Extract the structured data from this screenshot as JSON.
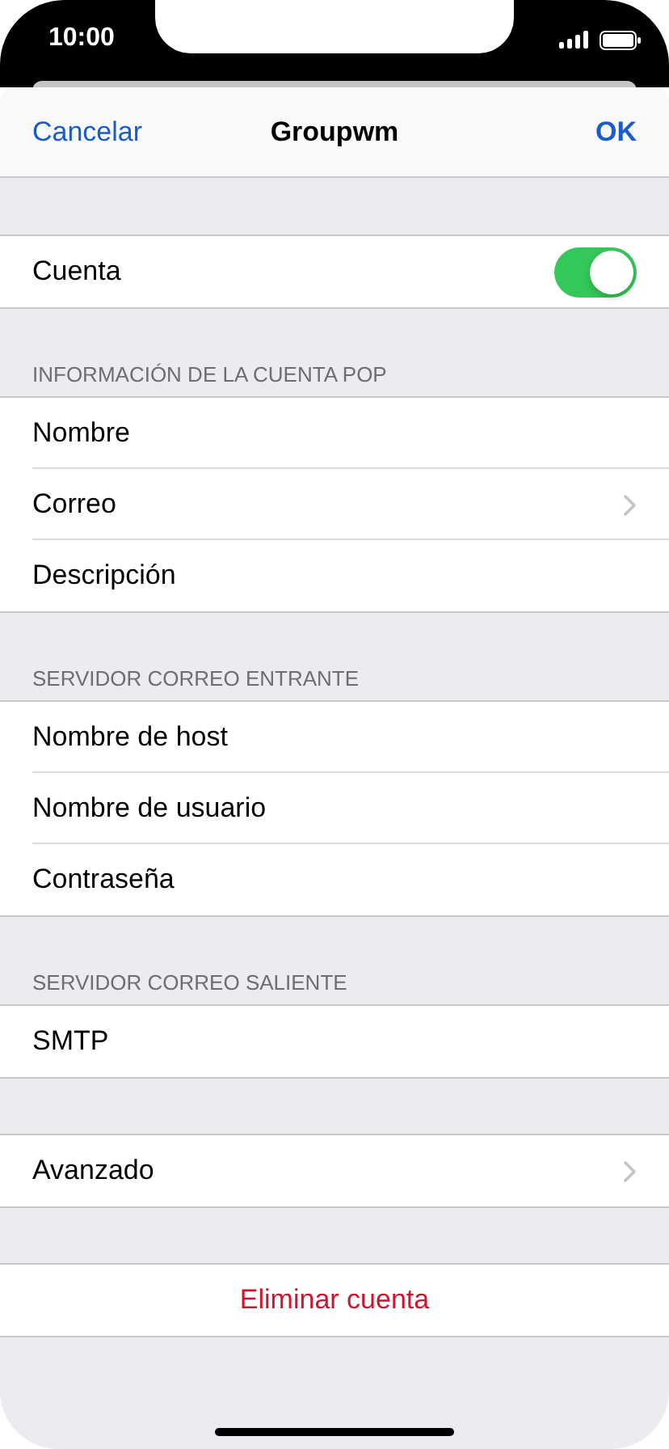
{
  "status_bar": {
    "time": "10:00"
  },
  "nav": {
    "cancel": "Cancelar",
    "title": "Groupwm",
    "done": "OK"
  },
  "sections": [
    {
      "rows": [
        {
          "kind": "toggle",
          "label": "Cuenta",
          "on": true
        }
      ]
    },
    {
      "header": "INFORMACIÓN DE LA CUENTA POP",
      "rows": [
        {
          "kind": "plain",
          "label": "Nombre"
        },
        {
          "kind": "disclosure",
          "label": "Correo"
        },
        {
          "kind": "plain",
          "label": "Descripción"
        }
      ]
    },
    {
      "header": "SERVIDOR CORREO ENTRANTE",
      "rows": [
        {
          "kind": "plain",
          "label": "Nombre de host"
        },
        {
          "kind": "plain",
          "label": "Nombre de usuario"
        },
        {
          "kind": "plain",
          "label": "Contraseña"
        }
      ]
    },
    {
      "header": "SERVIDOR CORREO SALIENTE",
      "rows": [
        {
          "kind": "plain",
          "label": "SMTP"
        }
      ]
    },
    {
      "rows": [
        {
          "kind": "disclosure",
          "label": "Avanzado"
        }
      ]
    },
    {
      "rows": [
        {
          "kind": "action",
          "label": "Eliminar cuenta"
        }
      ]
    }
  ]
}
